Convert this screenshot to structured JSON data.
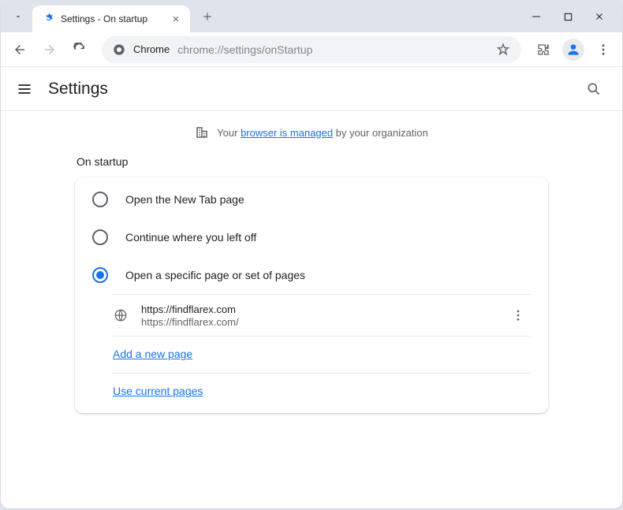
{
  "tab": {
    "title": "Settings - On startup"
  },
  "omnibox": {
    "chip_label": "Chrome",
    "url": "chrome://settings/onStartup"
  },
  "header": {
    "title": "Settings"
  },
  "managed": {
    "prefix": "Your ",
    "link": "browser is managed",
    "suffix": " by your organization"
  },
  "section": {
    "title": "On startup",
    "options": [
      {
        "label": "Open the New Tab page",
        "selected": false
      },
      {
        "label": "Continue where you left off",
        "selected": false
      },
      {
        "label": "Open a specific page or set of pages",
        "selected": true
      }
    ],
    "pages": [
      {
        "title": "https://findflarex.com",
        "url": "https://findflarex.com/"
      }
    ],
    "add_link": "Add a new page",
    "use_current_link": "Use current pages"
  }
}
